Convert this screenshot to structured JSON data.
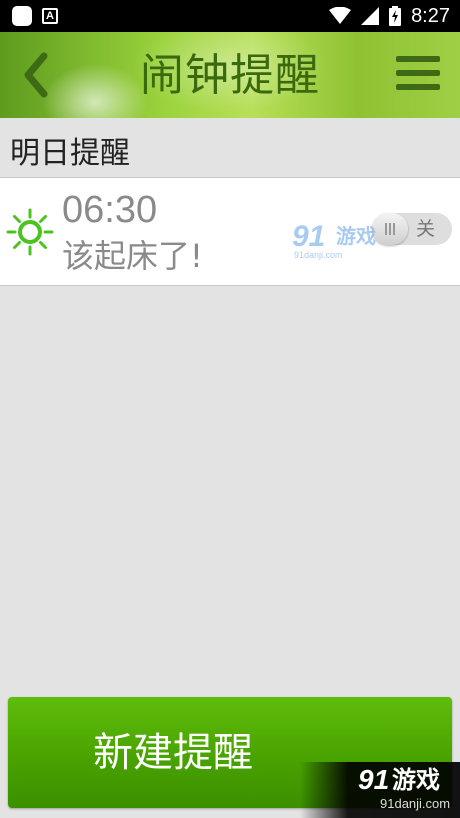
{
  "status_bar": {
    "time": "8:27",
    "notification_letter": "A"
  },
  "header": {
    "title": "闹钟提醒"
  },
  "section": {
    "label": "明日提醒"
  },
  "alarm": {
    "time": "06:30",
    "message": "该起床了!",
    "toggle_label": "关",
    "enabled": false
  },
  "new_button": {
    "label": "新建提醒"
  },
  "watermark": {
    "brand_num": "91",
    "brand_word": "游戏",
    "domain": "91danji.com"
  },
  "colors": {
    "accent_green": "#4caf0a",
    "header_green": "#9ad23c",
    "sun_icon": "#4cc420"
  }
}
